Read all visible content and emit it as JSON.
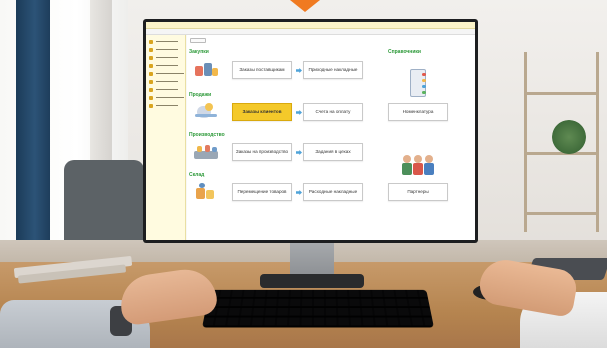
{
  "sections": {
    "purchases": "Закупки",
    "sales": "Продажи",
    "production": "Производство",
    "warehouse": "Склад",
    "reference": "Справочники"
  },
  "buttons": {
    "supplier_orders": "Заказы поставщикам",
    "receipt_invoices": "Приходные накладные",
    "client_orders": "Заказы клиентов",
    "payment_invoices": "Счета на оплату",
    "nomenclature": "Номенклатура",
    "production_orders": "Заказы на производство",
    "shop_tasks": "Задания в цехах",
    "goods_transfer": "Перемещение товаров",
    "expense_invoices": "Расходные накладные",
    "partners": "Партнеры"
  },
  "sidebar": {
    "item_count": 9
  },
  "colors": {
    "section_title": "#2e9a3a",
    "active_button": "#f4c92a",
    "arrow": "#4fa3d9",
    "sidebar_bg": "#fffbe0",
    "accent_tab": "#f07a21"
  }
}
